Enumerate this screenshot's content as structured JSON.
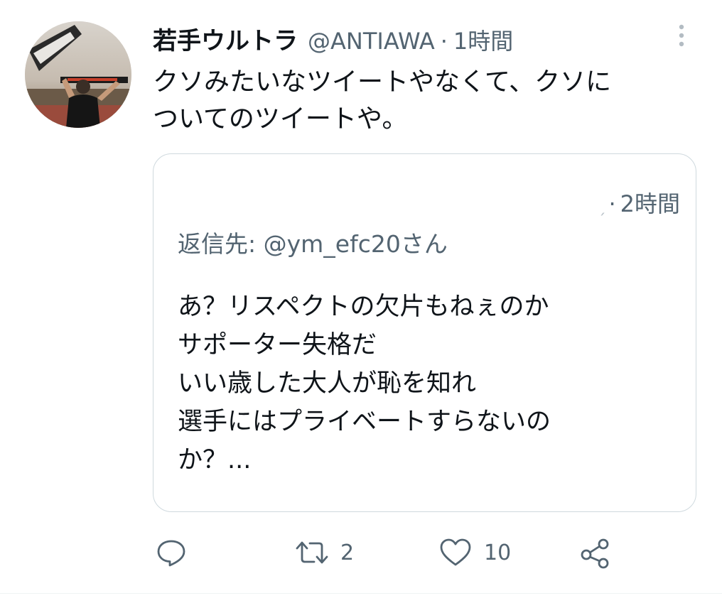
{
  "tweet": {
    "display_name": "若手ウルトラ",
    "handle": "@ANTIAWA",
    "separator": "·",
    "time": "1時間",
    "text": "クソみたいなツイートやなくて、クソに\nついてのツイートや。"
  },
  "quoted_tweet": {
    "time_separator": "·",
    "time": "2時間",
    "replying_to": "返信先: @ym_efc20さん",
    "text": "あ？リスペクトの欠片もねぇのか\nサポーター失格だ\nいい歳した大人が恥を知れ\n選手にはプライベートすらないの\nか？..."
  },
  "actions": {
    "reply_icon": "reply-icon",
    "retweet_icon": "retweet-icon",
    "retweet_count": "2",
    "like_icon": "heart-icon",
    "like_count": "10",
    "share_icon": "share-icon"
  },
  "colors": {
    "text_primary": "#0f1419",
    "text_secondary": "#536471",
    "border": "#cfd9de"
  }
}
